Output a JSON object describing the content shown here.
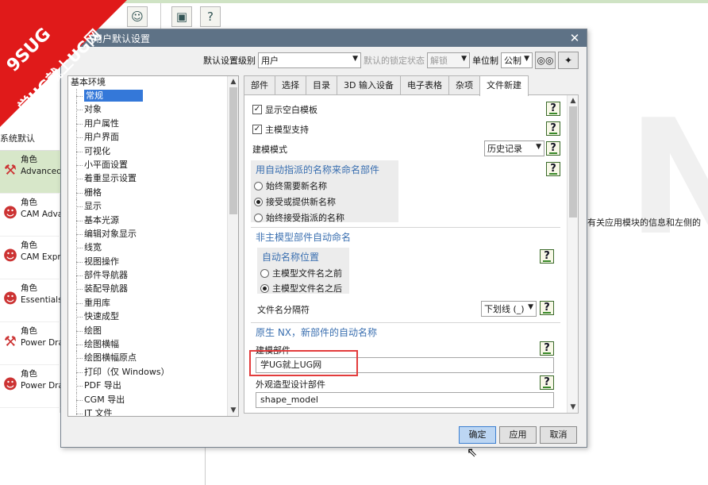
{
  "logo": {
    "line1": "9SUG",
    "line2": "学UG就上UG网"
  },
  "background": {
    "panel_title": "系统默认",
    "roles": [
      {
        "line1": "角色",
        "line2": "Advanced"
      },
      {
        "line1": "角色",
        "line2": "CAM Adva"
      },
      {
        "line1": "角色",
        "line2": "CAM Expre"
      },
      {
        "line1": "角色",
        "line2": "Essentials"
      },
      {
        "line1": "角色",
        "line2": "Power Dra"
      },
      {
        "line1": "角色",
        "line2": "Power Dra"
      }
    ],
    "right_text": "有关应用模块的信息和左侧的",
    "watermark": "N"
  },
  "dialog": {
    "title": "用户默认设置",
    "close_glyph": "✕",
    "level_label": "默认设置级别",
    "level_value": "用户",
    "lock_label": "默认的锁定状态",
    "lock_value": "解锁",
    "unit_label": "单位制",
    "unit_value": "公制",
    "tree": {
      "root": "基本环境",
      "items": [
        "常规",
        "对象",
        "用户属性",
        "用户界面",
        "可视化",
        "小平面设置",
        "着重显示设置",
        "栅格",
        "显示",
        "基本光源",
        "编辑对象显示",
        "线宽",
        "视图操作",
        "部件导航器",
        "装配导航器",
        "重用库",
        "快速成型",
        "绘图",
        "绘图横幅",
        "绘图横幅原点",
        "打印（仅 Windows）",
        "PDF 导出",
        "CGM 导出",
        "JT 文件"
      ],
      "selected_index": 0
    },
    "tabs": [
      "部件",
      "选择",
      "目录",
      "3D 输入设备",
      "电子表格",
      "杂项",
      "文件新建"
    ],
    "active_tab": 6,
    "panel": {
      "show_blank_template": "显示空白模板",
      "master_model_support": "主模型支持",
      "modeling_mode_label": "建模模式",
      "modeling_mode_value": "历史记录",
      "auto_name_group_title": "用自动指派的名称来命名部件",
      "radio_always_new": "始终需要新名称",
      "radio_accept_or_provide": "接受或提供新名称",
      "radio_always_accept": "始终接受指派的名称",
      "non_master_title": "非主模型部件自动命名",
      "auto_name_pos_title": "自动名称位置",
      "radio_before": "主模型文件名之前",
      "radio_after": "主模型文件名之后",
      "separator_label": "文件名分隔符",
      "separator_value": "下划线 (_)",
      "native_title": "原生 NX，新部件的自动名称",
      "modeling_part_label": "建模部件",
      "modeling_part_value": "学UG就上UG网",
      "styling_part_label": "外观造型设计部件",
      "styling_part_value": "shape_model",
      "help_glyph": "?"
    },
    "buttons": {
      "ok": "确定",
      "apply": "应用",
      "cancel": "取消"
    }
  }
}
